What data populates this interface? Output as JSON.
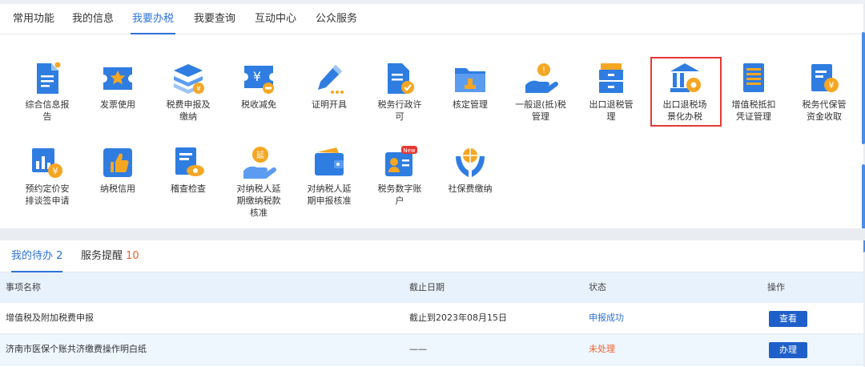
{
  "tabs": [
    "常用功能",
    "我的信息",
    "我要办税",
    "我要查询",
    "互动中心",
    "公众服务"
  ],
  "active_tab_index": 2,
  "functions_row1": [
    {
      "lines": [
        "综合信息报",
        "告"
      ],
      "icon": "document-list-icon"
    },
    {
      "lines": [
        "发票使用"
      ],
      "icon": "invoice-star-icon"
    },
    {
      "lines": [
        "税费申报及",
        "缴纳"
      ],
      "icon": "layers-coin-icon"
    },
    {
      "lines": [
        "税收减免"
      ],
      "icon": "yen-ticket-minus-icon"
    },
    {
      "lines": [
        "证明开具"
      ],
      "icon": "pencil-icon"
    },
    {
      "lines": [
        "税务行政许",
        "可"
      ],
      "icon": "document-check-icon"
    },
    {
      "lines": [
        "核定管理"
      ],
      "icon": "folder-stamp-icon"
    },
    {
      "lines": [
        "一般退(抵)税",
        "管理"
      ],
      "icon": "hand-coin-icon"
    },
    {
      "lines": [
        "出口退税管",
        "理"
      ],
      "icon": "cabinet-icon"
    },
    {
      "lines": [
        "出口退税场",
        "景化办税"
      ],
      "icon": "bank-gear-icon"
    },
    {
      "lines": [
        "增值税抵扣",
        "凭证管理"
      ],
      "icon": "document-stack-icon"
    },
    {
      "lines": [
        "税务代保管",
        "资金收取"
      ],
      "icon": "document-yen-icon"
    }
  ],
  "functions_row2": [
    {
      "lines": [
        "预约定价安",
        "排谈签申请"
      ],
      "icon": "chart-yen-icon"
    },
    {
      "lines": [
        "纳税信用"
      ],
      "icon": "thumbs-up-icon"
    },
    {
      "lines": [
        "稽查检查"
      ],
      "icon": "document-eye-icon"
    },
    {
      "lines": [
        "对纳税人延",
        "期缴纳税款",
        "核准"
      ],
      "icon": "hand-delay-icon"
    },
    {
      "lines": [
        "对纳税人延",
        "期申报核准"
      ],
      "icon": "wallet-icon"
    },
    {
      "lines": [
        "税务数字账",
        "户"
      ],
      "icon": "account-card-icon",
      "badge": "New"
    },
    {
      "lines": [
        "社保费缴纳"
      ],
      "icon": "hands-globe-icon"
    }
  ],
  "todo": {
    "tabs": [
      {
        "label": "我的待办",
        "count": "2"
      },
      {
        "label": "服务提醒",
        "count": "10"
      }
    ],
    "columns": [
      "事项名称",
      "截止日期",
      "状态",
      "操作"
    ],
    "rows": [
      {
        "name": "增值税及附加税费申报",
        "deadline": "截止到2023年08月15日",
        "status": "申报成功",
        "action": "查看"
      },
      {
        "name": "济南市医保个账共济缴费操作明白纸",
        "deadline": "——",
        "status": "未处理",
        "action": "办理"
      }
    ]
  },
  "colors": {
    "accent": "#2c72d8",
    "icon_blue": "#2f7de1",
    "icon_orange": "#f5a623",
    "warning": "#f0622d",
    "highlight": "#e53935"
  }
}
